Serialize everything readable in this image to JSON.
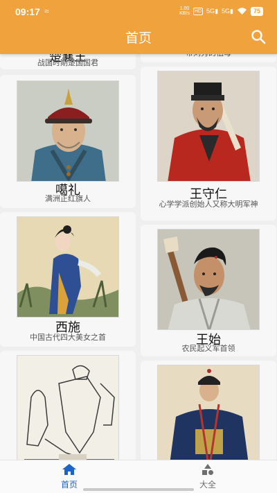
{
  "status_bar": {
    "time": "09:17",
    "network_speed_value": "1.00",
    "network_speed_unit": "KB/s",
    "hd_badge": "HD",
    "signal1": "5G",
    "signal2": "5G",
    "battery": "75"
  },
  "app_bar": {
    "title": "首页"
  },
  "colors": {
    "app_bar": "#f0a23c",
    "nav_active": "#1e63c6",
    "nav_inactive": "#6e6e6e"
  },
  "cards_left": [
    {
      "name": "楚襄王",
      "desc": "战国时期楚国国君"
    },
    {
      "name": "噶礼",
      "desc": "满洲正红旗人"
    },
    {
      "name": "西施",
      "desc": "中国古代四大美女之首"
    },
    {
      "name": "",
      "desc": ""
    }
  ],
  "cards_right": [
    {
      "name": "",
      "desc": "帝刘秀的祖母"
    },
    {
      "name": "王守仁",
      "desc": "心学学派创始人又称大明军神"
    },
    {
      "name": "王始",
      "desc": "农民起义军首领"
    },
    {
      "name": "",
      "desc": ""
    }
  ],
  "bottom_nav": [
    {
      "label": "首页",
      "icon": "home-icon",
      "active": true
    },
    {
      "label": "大全",
      "icon": "category-icon",
      "active": false
    }
  ]
}
